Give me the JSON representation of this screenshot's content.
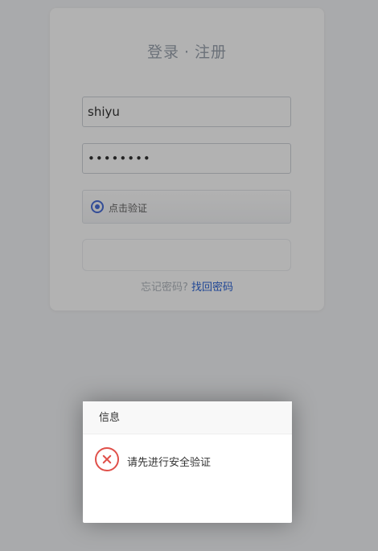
{
  "login": {
    "title_left": "登录",
    "title_sep": "·",
    "title_right": "注册",
    "username_value": "shiyu",
    "password_value": "••••••••",
    "captcha_label": "点击验证",
    "forgot_text": "忘记密码?",
    "forgot_link": "找回密码"
  },
  "dialog": {
    "title": "信息",
    "message": "请先进行安全验证"
  },
  "icons": {
    "captcha": "radio-target-icon",
    "error": "error-circle-x-icon"
  },
  "colors": {
    "accent": "#4a6fd8",
    "link": "#2f66d6",
    "error": "#e0504a"
  }
}
